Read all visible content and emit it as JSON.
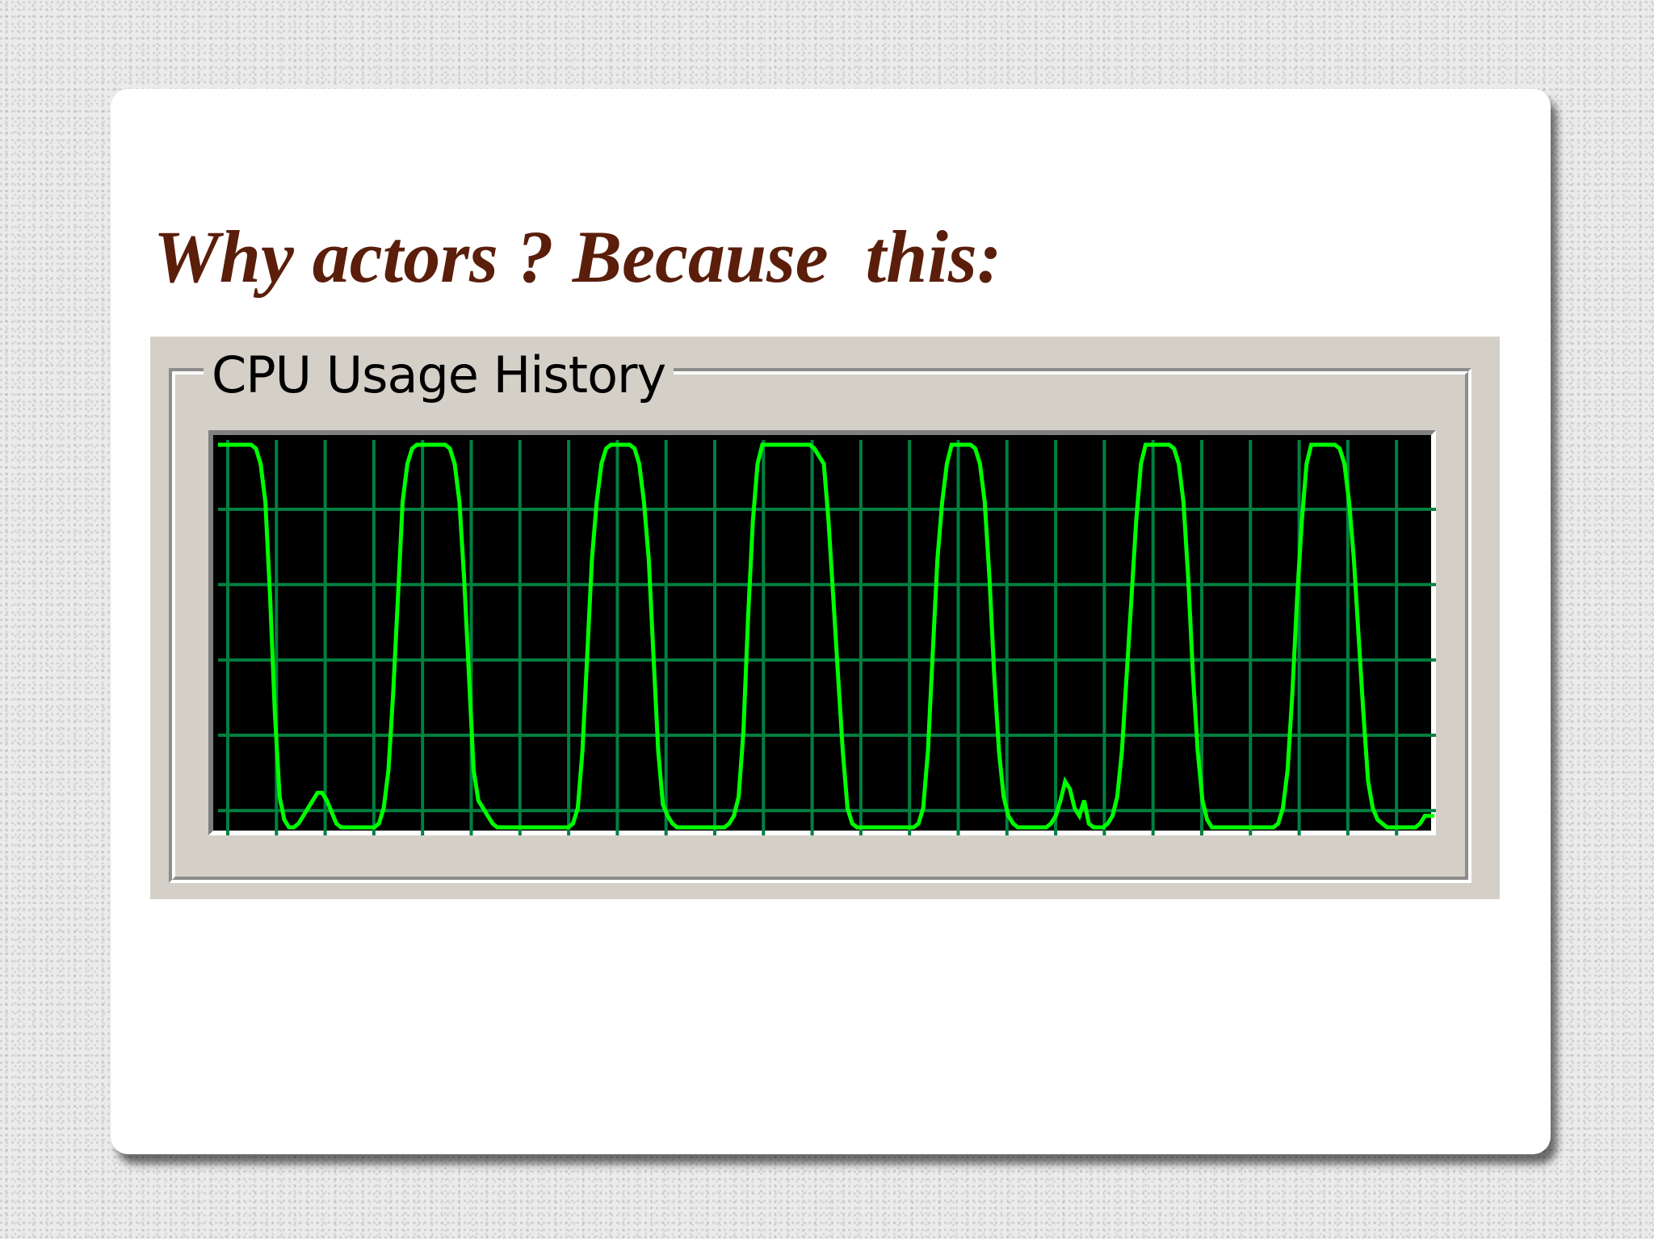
{
  "slide": {
    "title": "Why actors ? Because  this:"
  },
  "cpu_panel": {
    "group_label": "CPU Usage History"
  },
  "colors": {
    "title": "#5a1e0b",
    "panel_face": "#d4d0c8",
    "graph_background": "#000000",
    "grid_lines": "#008040",
    "usage_line": "#00ff00"
  },
  "chart_data": {
    "type": "line",
    "title": "CPU Usage History",
    "xlabel": "",
    "ylabel": "",
    "ylim": [
      0,
      100
    ],
    "grid": true,
    "series": [
      {
        "values": [
          100,
          100,
          100,
          100,
          100,
          100,
          100,
          100,
          99,
          95,
          85,
          60,
          30,
          8,
          2,
          0,
          0,
          1,
          3,
          5,
          7,
          9,
          9,
          7,
          4,
          1,
          0,
          0,
          0,
          0,
          0,
          0,
          0,
          0,
          1,
          5,
          15,
          35,
          60,
          85,
          95,
          99,
          100,
          100,
          100,
          100,
          100,
          100,
          100,
          99,
          95,
          85,
          65,
          40,
          15,
          7,
          5,
          3,
          1,
          0,
          0,
          0,
          0,
          0,
          0,
          0,
          0,
          0,
          0,
          0,
          0,
          0,
          0,
          0,
          0,
          1,
          5,
          20,
          45,
          70,
          85,
          95,
          99,
          100,
          100,
          100,
          100,
          100,
          99,
          95,
          85,
          70,
          45,
          20,
          6,
          3,
          1,
          0,
          0,
          0,
          0,
          0,
          0,
          0,
          0,
          0,
          0,
          0,
          1,
          3,
          8,
          25,
          55,
          80,
          95,
          100,
          100,
          100,
          100,
          100,
          100,
          100,
          100,
          100,
          100,
          100,
          99,
          97,
          95,
          80,
          60,
          40,
          20,
          5,
          1,
          0,
          0,
          0,
          0,
          0,
          0,
          0,
          0,
          0,
          0,
          0,
          0,
          0,
          1,
          5,
          20,
          45,
          70,
          85,
          95,
          100,
          100,
          100,
          100,
          100,
          99,
          95,
          85,
          65,
          40,
          20,
          8,
          3,
          1,
          0,
          0,
          0,
          0,
          0,
          0,
          0,
          1,
          3,
          7,
          12,
          10,
          5,
          3,
          7,
          1,
          0,
          0,
          0,
          1,
          3,
          8,
          20,
          40,
          60,
          80,
          95,
          100,
          100,
          100,
          100,
          100,
          100,
          99,
          95,
          85,
          65,
          40,
          20,
          7,
          2,
          0,
          0,
          0,
          0,
          0,
          0,
          0,
          0,
          0,
          0,
          0,
          0,
          0,
          0,
          1,
          5,
          15,
          35,
          60,
          80,
          95,
          100,
          100,
          100,
          100,
          100,
          100,
          99,
          95,
          85,
          70,
          50,
          30,
          12,
          5,
          2,
          1,
          0,
          0,
          0,
          0,
          0,
          0,
          0,
          1,
          3,
          3,
          3
        ]
      }
    ]
  }
}
